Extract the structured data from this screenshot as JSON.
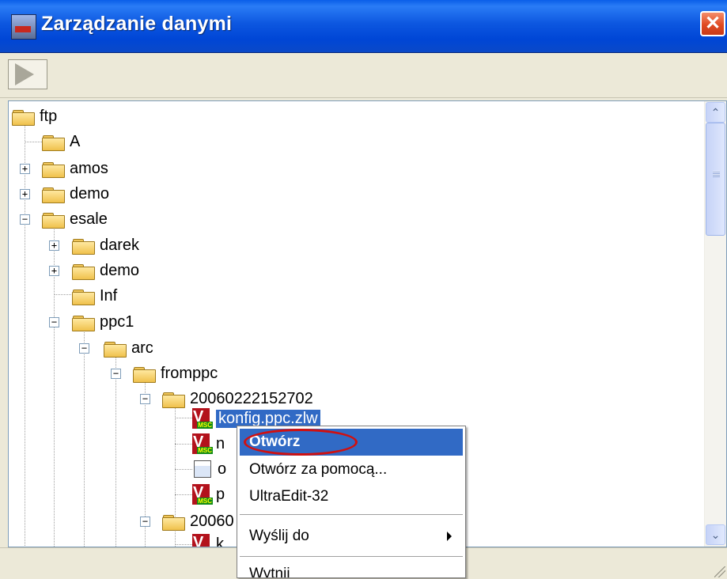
{
  "window": {
    "title": "Zarządzanie danymi",
    "close_glyph": "✕"
  },
  "toolbar": {
    "run_icon": "play-arrow-icon"
  },
  "tree": {
    "nodes": [
      {
        "label": "ftp"
      },
      {
        "label": "A"
      },
      {
        "label": "amos",
        "expander": "+"
      },
      {
        "label": "demo",
        "expander": "+"
      },
      {
        "label": "esale",
        "expander": "−"
      },
      {
        "label": "darek",
        "expander": "+"
      },
      {
        "label": "demo",
        "expander": "+"
      },
      {
        "label": "Inf"
      },
      {
        "label": "ppc1",
        "expander": "−"
      },
      {
        "label": "arc",
        "expander": "−"
      },
      {
        "label": "fromppc",
        "expander": "−"
      },
      {
        "label": "20060222152702",
        "expander": "−"
      },
      {
        "label": "konfig.ppc.zlw",
        "selected": true
      },
      {
        "label": "n"
      },
      {
        "label": "o"
      },
      {
        "label": "p"
      },
      {
        "label": "20060",
        "expander": "−"
      },
      {
        "label": "k"
      }
    ]
  },
  "context_menu": {
    "items": [
      {
        "label": "Otwórz",
        "highlighted": true
      },
      {
        "label": "Otwórz za pomocą..."
      },
      {
        "label": "UltraEdit-32"
      },
      {
        "label": "Wyślij do",
        "submenu": true
      },
      {
        "label": "Wytnij"
      }
    ]
  },
  "scrollbar": {
    "up_glyph": "⌃",
    "down_glyph": "⌄"
  },
  "colors": {
    "titlebar": "#0a5ee8",
    "selection": "#316ac5",
    "annotation": "#d01010"
  }
}
